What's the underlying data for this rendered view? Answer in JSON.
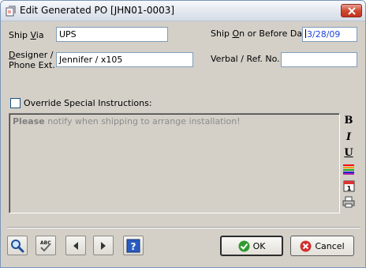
{
  "window": {
    "title": "Edit Generated PO [JHN01-0003]"
  },
  "form": {
    "ship_via_label_pre": "Ship ",
    "ship_via_label_u": "V",
    "ship_via_label_post": "ia",
    "ship_via_value": "UPS",
    "ship_on_label_pre": "Ship ",
    "ship_on_label_u": "O",
    "ship_on_label_post": "n or Before Date",
    "ship_on_value": "3/28/09",
    "designer_label_line1_u": "D",
    "designer_label_line1_post": "esigner /",
    "designer_label_line2": "Phone Ext.",
    "designer_value": "Jennifer / x105",
    "verbal_label": "Verbal / Ref. No.",
    "verbal_value": "",
    "override_label": "Override Special Instructions:",
    "override_checked": false
  },
  "notes": {
    "bold_word": "Please",
    "rest": " notify when shipping to arrange installation!"
  },
  "format_toolbar": {
    "bold": "B",
    "italic": "I",
    "underline": "U"
  },
  "buttons": {
    "ok": "OK",
    "cancel": "Cancel"
  },
  "colors": {
    "ok_icon": "#2f9a2f",
    "cancel_icon": "#d12f2f",
    "link_blue": "#1e44d6"
  }
}
